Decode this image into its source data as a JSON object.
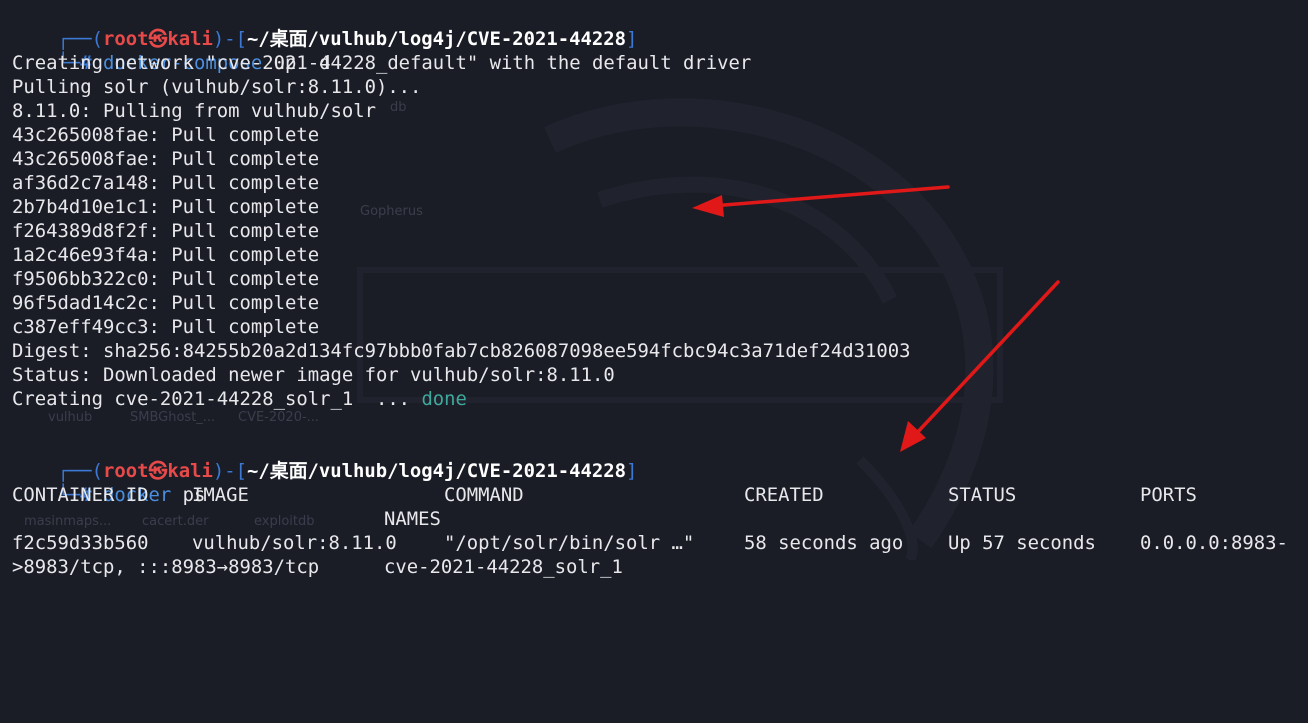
{
  "prompt": {
    "frame_top": "┌──(",
    "user": "root",
    "skull": "㉿",
    "host": "kali",
    "frame_mid": ")-[",
    "path": "~/桌面/vulhub/log4j/CVE-2021-44228",
    "frame_end": "]",
    "frame_bottom": "└─",
    "hash": "#"
  },
  "block1": {
    "command_name": "docker-compose",
    "command_args": " up -d",
    "output": [
      "Creating network \"cve-2021-44228_default\" with the default driver",
      "Pulling solr (vulhub/solr:8.11.0)...",
      "8.11.0: Pulling from vulhub/solr",
      "43c265008fae: Pull complete",
      "43c265008fae: Pull complete",
      "af36d2c7a148: Pull complete",
      "2b7b4d10e1c1: Pull complete",
      "f264389d8f2f: Pull complete",
      "1a2c46e93f4a: Pull complete",
      "f9506bb322c0: Pull complete",
      "96f5dad14c2c: Pull complete",
      "c387eff49cc3: Pull complete",
      "Digest: sha256:84255b20a2d134fc97bbb0fab7cb826087098ee594fcbc94c3a71def24d31003",
      "Status: Downloaded newer image for vulhub/solr:8.11.0"
    ],
    "creating_text": "Creating cve-2021-44228_solr_1  ... ",
    "done_text": "done"
  },
  "block2": {
    "command_name": "docker",
    "command_args": " ps",
    "headers": {
      "container_id": "CONTAINER ID",
      "image": "IMAGE",
      "command": "COMMAND",
      "created": "CREATED",
      "status": "STATUS",
      "ports": "PORTS",
      "names": "NAMES"
    },
    "row": {
      "container_id": "f2c59d33b560",
      "image": "vulhub/solr:8.11.0",
      "command": "\"/opt/solr/bin/solr …\"",
      "created": "58 seconds ago",
      "status": "Up 57 seconds",
      "ports_line1": "0.0.0.0:8983-",
      "ports_line2": ">8983/tcp, :::8983→8983/tcp",
      "names": "cve-2021-44228_solr_1"
    }
  },
  "colors": {
    "background": "#1b1d26",
    "prompt_frame": "#3b79d4",
    "prompt_user": "#e84a4a",
    "command": "#4a8fe0",
    "done": "#3fa89a",
    "arrow": "#e01818"
  }
}
